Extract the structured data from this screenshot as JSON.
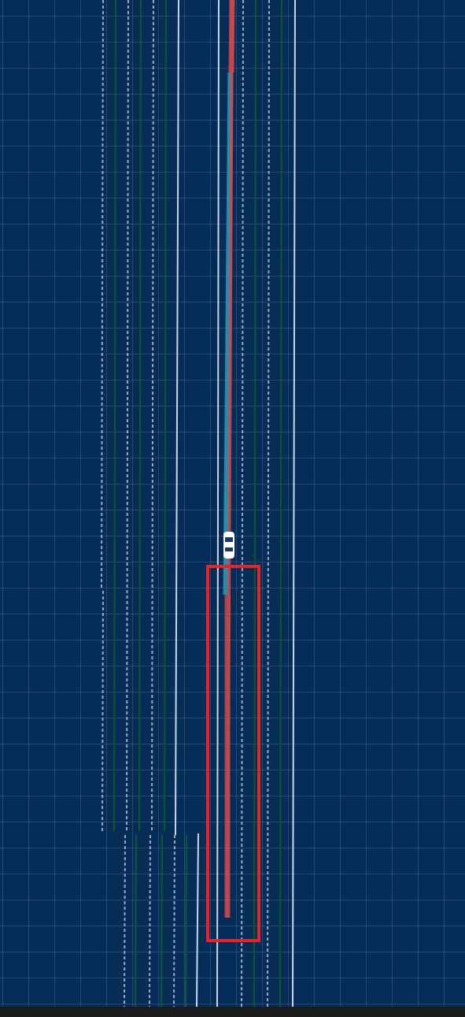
{
  "view": {
    "type": "top-down planning/map visualization",
    "grid": true
  },
  "colors": {
    "background": "#062d57",
    "grid": "#5a7ea8",
    "lane_boundary_white": "#c9d6e6",
    "lane_boundary_dashed": "#aebfd3",
    "lane_center_green": "#0c5a2c",
    "planned_path_red": "#d2484a",
    "reference_line_cyan": "#2aa0b8",
    "highlight_box": "#e8222a",
    "ego_vehicle": "#ffffff"
  },
  "icons": {
    "ego_vehicle": "car-icon"
  }
}
